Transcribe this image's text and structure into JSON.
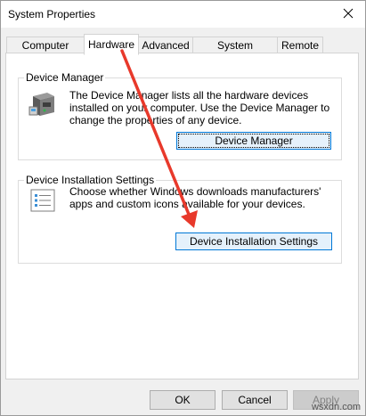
{
  "window": {
    "title": "System Properties"
  },
  "tabs": [
    {
      "label": "Computer Name"
    },
    {
      "label": "Hardware"
    },
    {
      "label": "Advanced"
    },
    {
      "label": "System Protection"
    },
    {
      "label": "Remote"
    }
  ],
  "device_manager": {
    "group_label": "Device Manager",
    "description": "The Device Manager lists all the hardware devices installed on your computer. Use the Device Manager to change the properties of any device.",
    "button_label": "Device Manager"
  },
  "device_installation": {
    "group_label": "Device Installation Settings",
    "description": "Choose whether Windows downloads manufacturers' apps and custom icons available for your devices.",
    "button_label": "Device Installation Settings"
  },
  "footer": {
    "ok_label": "OK",
    "cancel_label": "Cancel",
    "apply_label": "Apply"
  },
  "watermark": "wsxdn.com",
  "colors": {
    "annotation_arrow": "#e8392b",
    "focus_border": "#0078d7"
  }
}
